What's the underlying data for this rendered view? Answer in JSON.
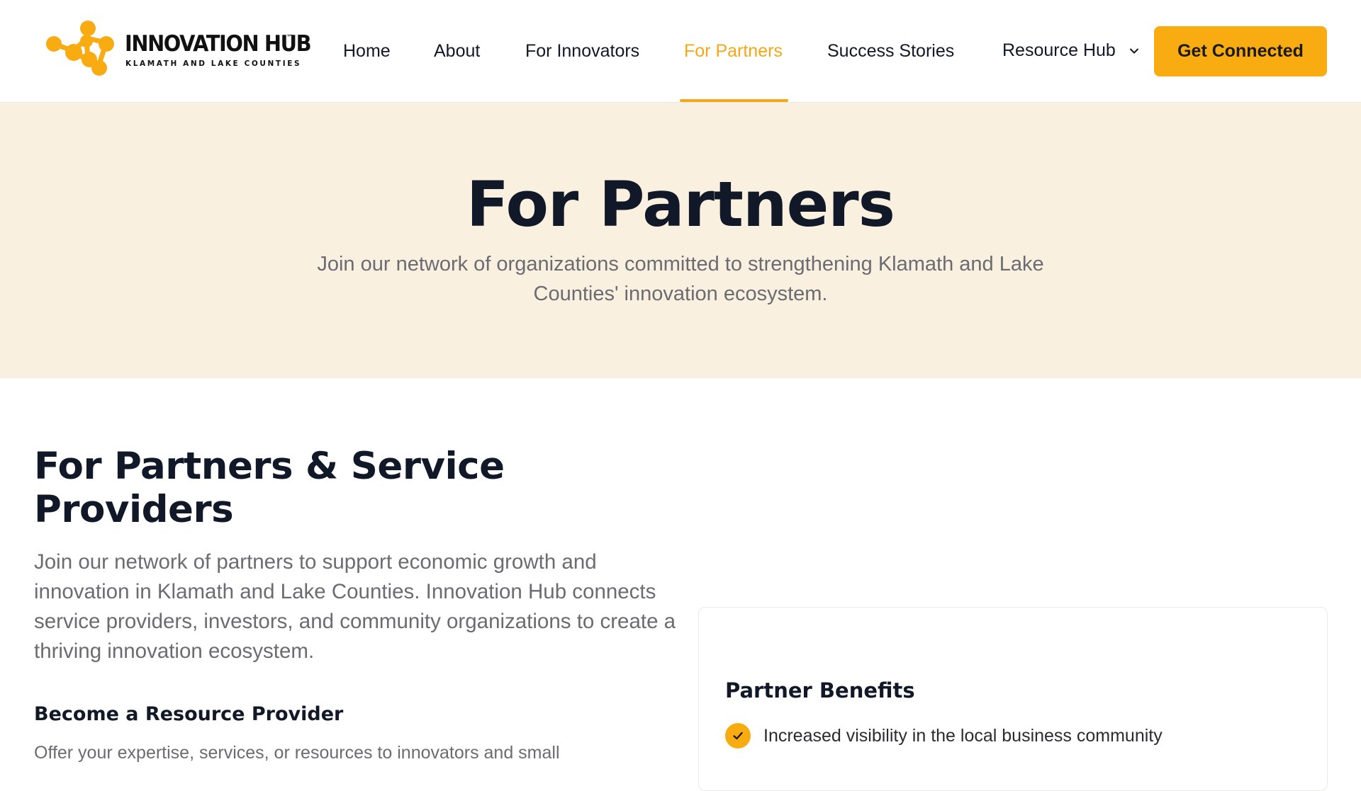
{
  "brand": {
    "name": "INNOVATION HUB",
    "trademark": "™",
    "tagline": "KLAMATH AND LAKE COUNTIES",
    "accent_color": "#f9ab12"
  },
  "nav": {
    "items": [
      {
        "label": "Home"
      },
      {
        "label": "About"
      },
      {
        "label": "For Innovators"
      },
      {
        "label": "For Partners",
        "active": true
      },
      {
        "label": "Success Stories"
      },
      {
        "label": "Resource Hub",
        "icon": "chevron-down-icon"
      }
    ],
    "cta_label": "Get Connected"
  },
  "hero": {
    "title": "For Partners",
    "subtitle": "Join our network of organizations committed to strengthening Klamath and Lake Counties' innovation ecosystem.",
    "background": "#faf0e0"
  },
  "main": {
    "title": "For Partners & Service Providers",
    "intro": "Join our network of partners to support economic growth and innovation in Klamath and Lake Counties. Innovation Hub connects service providers, investors, and community organizations to create a thriving innovation ecosystem.",
    "resource_provider": {
      "heading": "Become a Resource Provider",
      "text": "Offer your expertise, services, or resources to innovators and small"
    }
  },
  "benefits_card": {
    "title": "Partner Benefits",
    "items": [
      {
        "icon": "check-icon",
        "text": "Increased visibility in the local business community"
      }
    ]
  }
}
